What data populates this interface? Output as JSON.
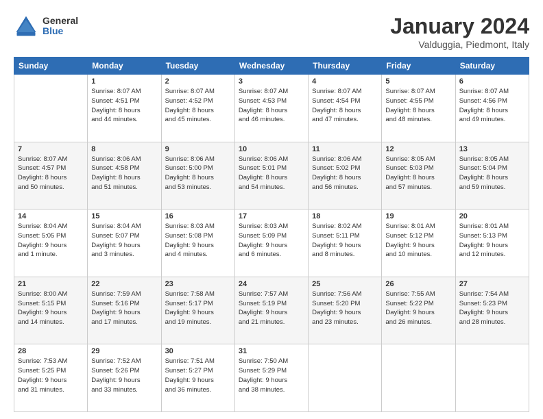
{
  "logo": {
    "general": "General",
    "blue": "Blue"
  },
  "header": {
    "month": "January 2024",
    "location": "Valduggia, Piedmont, Italy"
  },
  "weekdays": [
    "Sunday",
    "Monday",
    "Tuesday",
    "Wednesday",
    "Thursday",
    "Friday",
    "Saturday"
  ],
  "weeks": [
    [
      {
        "day": "",
        "info": ""
      },
      {
        "day": "1",
        "info": "Sunrise: 8:07 AM\nSunset: 4:51 PM\nDaylight: 8 hours\nand 44 minutes."
      },
      {
        "day": "2",
        "info": "Sunrise: 8:07 AM\nSunset: 4:52 PM\nDaylight: 8 hours\nand 45 minutes."
      },
      {
        "day": "3",
        "info": "Sunrise: 8:07 AM\nSunset: 4:53 PM\nDaylight: 8 hours\nand 46 minutes."
      },
      {
        "day": "4",
        "info": "Sunrise: 8:07 AM\nSunset: 4:54 PM\nDaylight: 8 hours\nand 47 minutes."
      },
      {
        "day": "5",
        "info": "Sunrise: 8:07 AM\nSunset: 4:55 PM\nDaylight: 8 hours\nand 48 minutes."
      },
      {
        "day": "6",
        "info": "Sunrise: 8:07 AM\nSunset: 4:56 PM\nDaylight: 8 hours\nand 49 minutes."
      }
    ],
    [
      {
        "day": "7",
        "info": "Sunrise: 8:07 AM\nSunset: 4:57 PM\nDaylight: 8 hours\nand 50 minutes."
      },
      {
        "day": "8",
        "info": "Sunrise: 8:06 AM\nSunset: 4:58 PM\nDaylight: 8 hours\nand 51 minutes."
      },
      {
        "day": "9",
        "info": "Sunrise: 8:06 AM\nSunset: 5:00 PM\nDaylight: 8 hours\nand 53 minutes."
      },
      {
        "day": "10",
        "info": "Sunrise: 8:06 AM\nSunset: 5:01 PM\nDaylight: 8 hours\nand 54 minutes."
      },
      {
        "day": "11",
        "info": "Sunrise: 8:06 AM\nSunset: 5:02 PM\nDaylight: 8 hours\nand 56 minutes."
      },
      {
        "day": "12",
        "info": "Sunrise: 8:05 AM\nSunset: 5:03 PM\nDaylight: 8 hours\nand 57 minutes."
      },
      {
        "day": "13",
        "info": "Sunrise: 8:05 AM\nSunset: 5:04 PM\nDaylight: 8 hours\nand 59 minutes."
      }
    ],
    [
      {
        "day": "14",
        "info": "Sunrise: 8:04 AM\nSunset: 5:05 PM\nDaylight: 9 hours\nand 1 minute."
      },
      {
        "day": "15",
        "info": "Sunrise: 8:04 AM\nSunset: 5:07 PM\nDaylight: 9 hours\nand 3 minutes."
      },
      {
        "day": "16",
        "info": "Sunrise: 8:03 AM\nSunset: 5:08 PM\nDaylight: 9 hours\nand 4 minutes."
      },
      {
        "day": "17",
        "info": "Sunrise: 8:03 AM\nSunset: 5:09 PM\nDaylight: 9 hours\nand 6 minutes."
      },
      {
        "day": "18",
        "info": "Sunrise: 8:02 AM\nSunset: 5:11 PM\nDaylight: 9 hours\nand 8 minutes."
      },
      {
        "day": "19",
        "info": "Sunrise: 8:01 AM\nSunset: 5:12 PM\nDaylight: 9 hours\nand 10 minutes."
      },
      {
        "day": "20",
        "info": "Sunrise: 8:01 AM\nSunset: 5:13 PM\nDaylight: 9 hours\nand 12 minutes."
      }
    ],
    [
      {
        "day": "21",
        "info": "Sunrise: 8:00 AM\nSunset: 5:15 PM\nDaylight: 9 hours\nand 14 minutes."
      },
      {
        "day": "22",
        "info": "Sunrise: 7:59 AM\nSunset: 5:16 PM\nDaylight: 9 hours\nand 17 minutes."
      },
      {
        "day": "23",
        "info": "Sunrise: 7:58 AM\nSunset: 5:17 PM\nDaylight: 9 hours\nand 19 minutes."
      },
      {
        "day": "24",
        "info": "Sunrise: 7:57 AM\nSunset: 5:19 PM\nDaylight: 9 hours\nand 21 minutes."
      },
      {
        "day": "25",
        "info": "Sunrise: 7:56 AM\nSunset: 5:20 PM\nDaylight: 9 hours\nand 23 minutes."
      },
      {
        "day": "26",
        "info": "Sunrise: 7:55 AM\nSunset: 5:22 PM\nDaylight: 9 hours\nand 26 minutes."
      },
      {
        "day": "27",
        "info": "Sunrise: 7:54 AM\nSunset: 5:23 PM\nDaylight: 9 hours\nand 28 minutes."
      }
    ],
    [
      {
        "day": "28",
        "info": "Sunrise: 7:53 AM\nSunset: 5:25 PM\nDaylight: 9 hours\nand 31 minutes."
      },
      {
        "day": "29",
        "info": "Sunrise: 7:52 AM\nSunset: 5:26 PM\nDaylight: 9 hours\nand 33 minutes."
      },
      {
        "day": "30",
        "info": "Sunrise: 7:51 AM\nSunset: 5:27 PM\nDaylight: 9 hours\nand 36 minutes."
      },
      {
        "day": "31",
        "info": "Sunrise: 7:50 AM\nSunset: 5:29 PM\nDaylight: 9 hours\nand 38 minutes."
      },
      {
        "day": "",
        "info": ""
      },
      {
        "day": "",
        "info": ""
      },
      {
        "day": "",
        "info": ""
      }
    ]
  ]
}
